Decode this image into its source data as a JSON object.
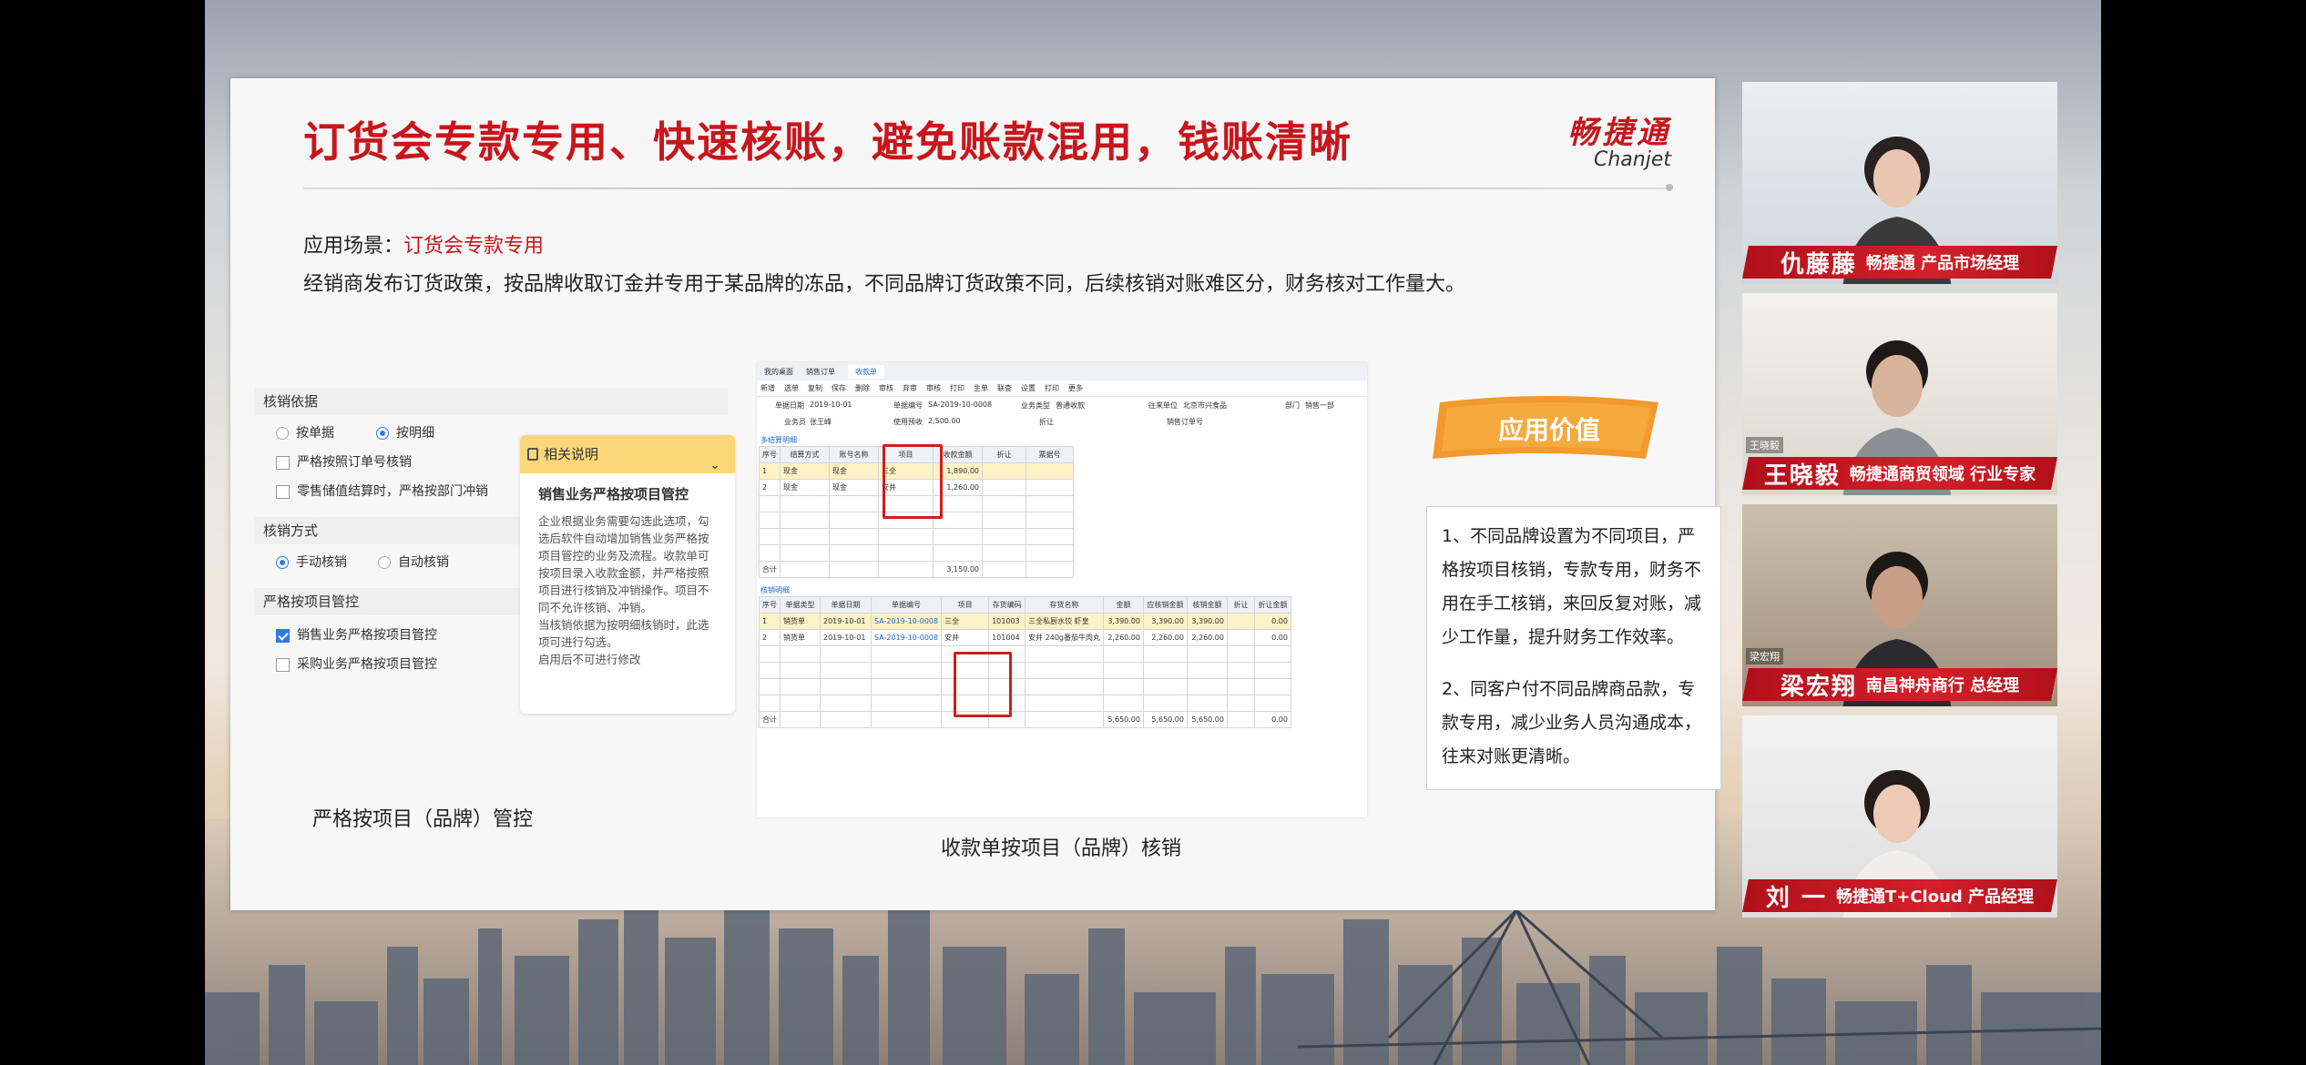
{
  "slide": {
    "title": "订货会专款专用、快速核账，避免账款混用，钱账清晰",
    "brand_cn": "畅捷通",
    "brand_en": "Chanjet",
    "scene_label": "应用场景：",
    "scene_value": "订货会专款专用",
    "description": "经销商发布订货政策，按品牌收取订金并专用于某品牌的冻品，不同品牌订货政策不同，后续核销对账难区分，财务核对工作量大。",
    "caption_left": "严格按项目（品牌）管控",
    "caption_right": "收款单按项目（品牌）核销"
  },
  "settings": {
    "section1": "核销依据",
    "opt_by_doc": "按单据",
    "opt_by_detail": "按明细",
    "chk_order_no": "严格按照订单号核销",
    "chk_retail": "零售储值结算时，严格按部门冲销",
    "section2": "核销方式",
    "opt_manual": "手动核销",
    "opt_auto": "自动核销",
    "section3": "严格按项目管控",
    "chk_sales_project": "销售业务严格按项目管控",
    "chk_purchase_project": "采购业务严格按项目管控"
  },
  "help": {
    "header": "相关说明",
    "title": "销售业务严格按项目管控",
    "body1": "企业根据业务需要勾选此选项，勾选后软件自动增加销售业务严格按项目管控的业务及流程。收款单可按项目录入收款金额，并严格按照项目进行核销及冲销操作。项目不同不允许核销、冲销。",
    "body2": "当核销依据为按明细核销时，此选项可进行勾选。",
    "body3": "启用后不可进行修改"
  },
  "erp": {
    "tabs": [
      "我的桌面",
      "销售订单",
      "收款单"
    ],
    "toolbar": [
      "新增",
      "选单",
      "复制",
      "保存",
      "删除",
      "审核",
      "弃审",
      "审核",
      "打印",
      "生单",
      "联查",
      "设置",
      "打印",
      "更多"
    ],
    "fields": {
      "date_label": "单据日期",
      "date_value": "2019-10-01",
      "code_label": "单据编号",
      "code_value": "SA-2019-10-0008",
      "type_label": "业务类型",
      "type_value": "普通收款",
      "customer_label": "往来单位",
      "customer_value": "北京市兴食品",
      "dept_label": "部门",
      "dept_value": "销售一部",
      "staff_label": "业务员",
      "staff_value": "张王峰",
      "amount_label": "使用预收",
      "amount_value": "2,500.00",
      "discount_label": "折让",
      "order_label": "销售订单号"
    },
    "grid1_title": "多结算明细",
    "grid1_headers": [
      "序号",
      "结算方式",
      "账号名称",
      "项目",
      "收款金额",
      "折让",
      "票据号"
    ],
    "grid1_rows": [
      [
        "1",
        "现金",
        "现金",
        "三全",
        "1,890.00",
        "",
        ""
      ],
      [
        "2",
        "现金",
        "现金",
        "安井",
        "1,260.00",
        "",
        ""
      ]
    ],
    "grid1_total_label": "合计",
    "grid1_total": "3,150.00",
    "grid2_title": "核销明细",
    "grid2_headers": [
      "序号",
      "单据类型",
      "单据日期",
      "单据编号",
      "项目",
      "存货编码",
      "存货名称",
      "金额",
      "应核销金额",
      "核销金额",
      "折让",
      "折让金额"
    ],
    "grid2_rows": [
      [
        "1",
        "销货单",
        "2019-10-01",
        "SA-2019-10-0008",
        "三全",
        "101003",
        "三全私厨水饺 虾皇",
        "3,390.00",
        "3,390.00",
        "3,390.00",
        "",
        "0.00"
      ],
      [
        "2",
        "销货单",
        "2019-10-01",
        "SA-2019-10-0008",
        "安井",
        "101004",
        "安井 240g番茄牛肉丸",
        "2,260.00",
        "2,260.00",
        "2,260.00",
        "",
        "0.00"
      ]
    ],
    "grid2_total_label": "合计",
    "grid2_totals": [
      "5,650.00",
      "5,650.00",
      "5,650.00",
      "0.00"
    ]
  },
  "value": {
    "badge": "应用价值",
    "p1": "1、不同品牌设置为不同项目，严格按项目核销，专款专用，财务不用在手工核销，来回反复对账，减少工作量，提升财务工作效率。",
    "p2": "2、同客户付不同品牌商品款，专款专用，减少业务人员沟通成本，往来对账更清晰。"
  },
  "speakers": [
    {
      "name": "仇藤藤",
      "role": "畅捷通 产品市场经理",
      "tag": ""
    },
    {
      "name": "王晓毅",
      "role": "畅捷通商贸领域 行业专家",
      "tag": "王晓毅"
    },
    {
      "name": "梁宏翔",
      "role": "南昌神舟商行 总经理",
      "tag": "梁宏翔"
    },
    {
      "name": "刘 一",
      "role": "畅捷通T+Cloud 产品经理",
      "tag": ""
    }
  ],
  "colors": {
    "accent": "#c8161d",
    "badge": "#f29a2e",
    "link": "#1b6ac9"
  }
}
